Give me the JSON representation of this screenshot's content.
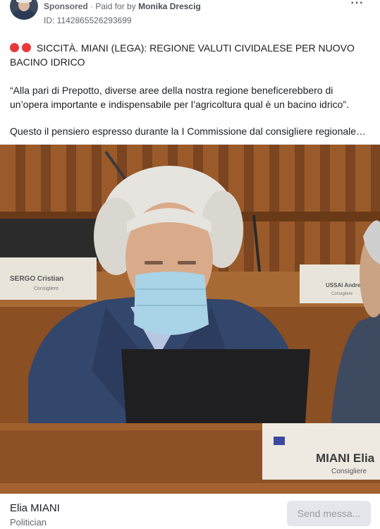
{
  "ad": {
    "sponsored_label": "Sponsored",
    "separator": "·",
    "paid_for_prefix": "Paid for by",
    "payer": "Monika Drescig",
    "id_text": "ID: 1142865526293699",
    "more_icon": "more-horizontal-icon"
  },
  "post": {
    "headline": "SICCITÀ. MIANI (LEGA): REGIONE VALUTI CIVIDALESE PER NUOVO BACINO IDRICO",
    "quote": "“Alla pari di Prepotto, diverse aree della nostra regione beneficerebbero di un’opera importante e indispensabile per l’agricoltura qual è un bacino idrico”.",
    "summary": "Questo il pensiero espresso durante la I Commissione dal consigliere regionale…",
    "dot_color": "#e8383b"
  },
  "photo": {
    "nameplate_left": "SERGO Cristian",
    "nameplate_left_role": "Consigliere",
    "nameplate_right": "USSAI Andrea",
    "nameplate_right_role": "Consigliere",
    "nameplate_front": "MIANI Elia",
    "nameplate_front_role": "Consigliere"
  },
  "footer": {
    "name": "Elia MIANI",
    "category": "Politician",
    "send_label": "Send messa..."
  }
}
